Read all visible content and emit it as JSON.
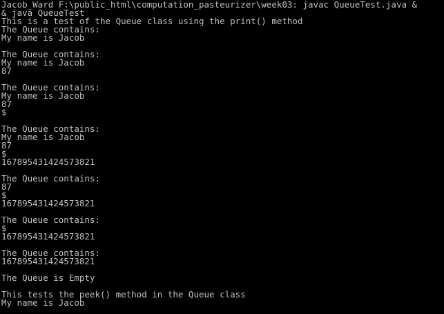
{
  "console": {
    "text_color": "#c0c0c0",
    "background_color": "#000000",
    "lines": [
      "Jacob_Ward F:\\public_html\\computation_pasteurizer\\week03: javac QueueTest.java &",
      "& java QueueTest",
      "This is a test of the Queue class using the print() method",
      "The Queue contains:",
      "My name is Jacob",
      "",
      "The Queue contains:",
      "My name is Jacob",
      "87",
      "",
      "The Queue contains:",
      "My name is Jacob",
      "87",
      "$",
      "",
      "The Queue contains:",
      "My name is Jacob",
      "87",
      "$",
      "167895431424573821",
      "",
      "The Queue contains:",
      "87",
      "$",
      "167895431424573821",
      "",
      "The Queue contains:",
      "$",
      "167895431424573821",
      "",
      "The Queue contains:",
      "167895431424573821",
      "",
      "The Queue is Empty",
      "",
      "This tests the peek() method in the Queue class",
      "My name is Jacob"
    ]
  }
}
